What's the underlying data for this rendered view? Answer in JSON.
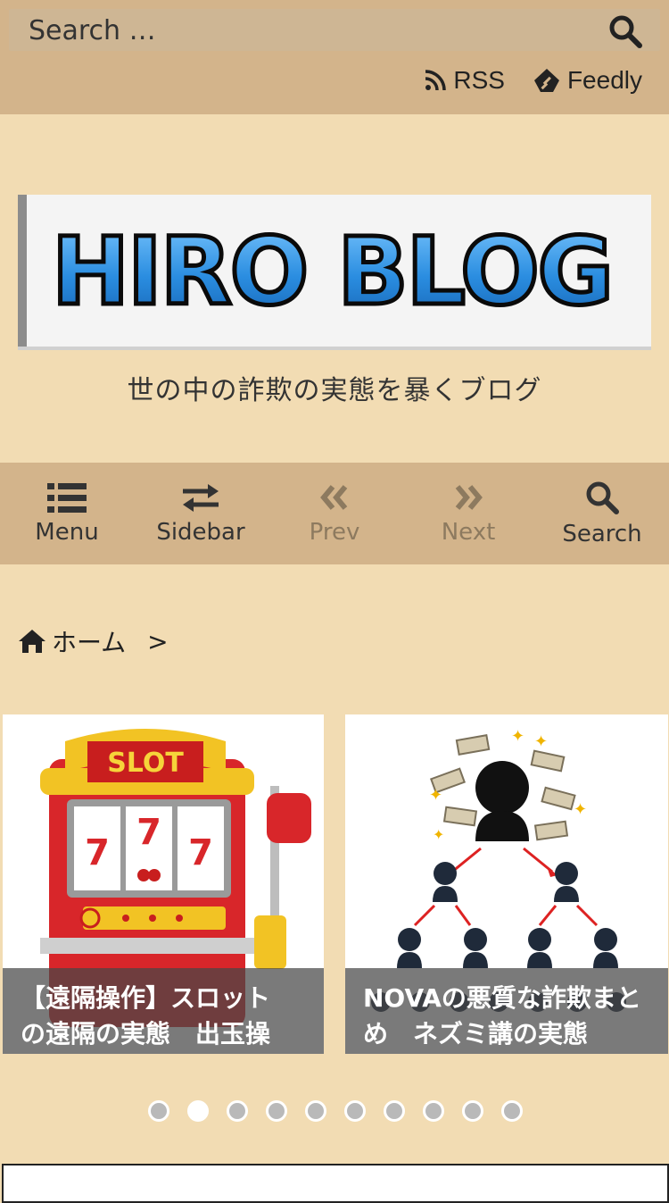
{
  "header": {
    "search_placeholder": "Search …",
    "rss_label": "RSS",
    "feedly_label": "Feedly"
  },
  "logo": {
    "text": "HIRO BLOG"
  },
  "tagline": "世の中の詐欺の実態を暴くブログ",
  "nav": {
    "menu": "Menu",
    "sidebar": "Sidebar",
    "prev": "Prev",
    "next": "Next",
    "search": "Search"
  },
  "breadcrumb": {
    "home": "ホーム",
    "separator": ">"
  },
  "carousel": {
    "cards": [
      {
        "title_line1": "【遠隔操作】スロット",
        "title_line2": "の遠隔の実態　出玉操",
        "image": "slot-machine-illustration"
      },
      {
        "title_line1": "NOVAの悪質な詐欺まと",
        "title_line2": "め　ネズミ講の実態",
        "image": "pyramid-scheme-illustration"
      }
    ],
    "dot_count": 10,
    "active_dot": 2
  },
  "colors": {
    "page_bg": "#f2dcb3",
    "header_bg": "#d3b48b",
    "logo_blue": "#2a8de0"
  }
}
